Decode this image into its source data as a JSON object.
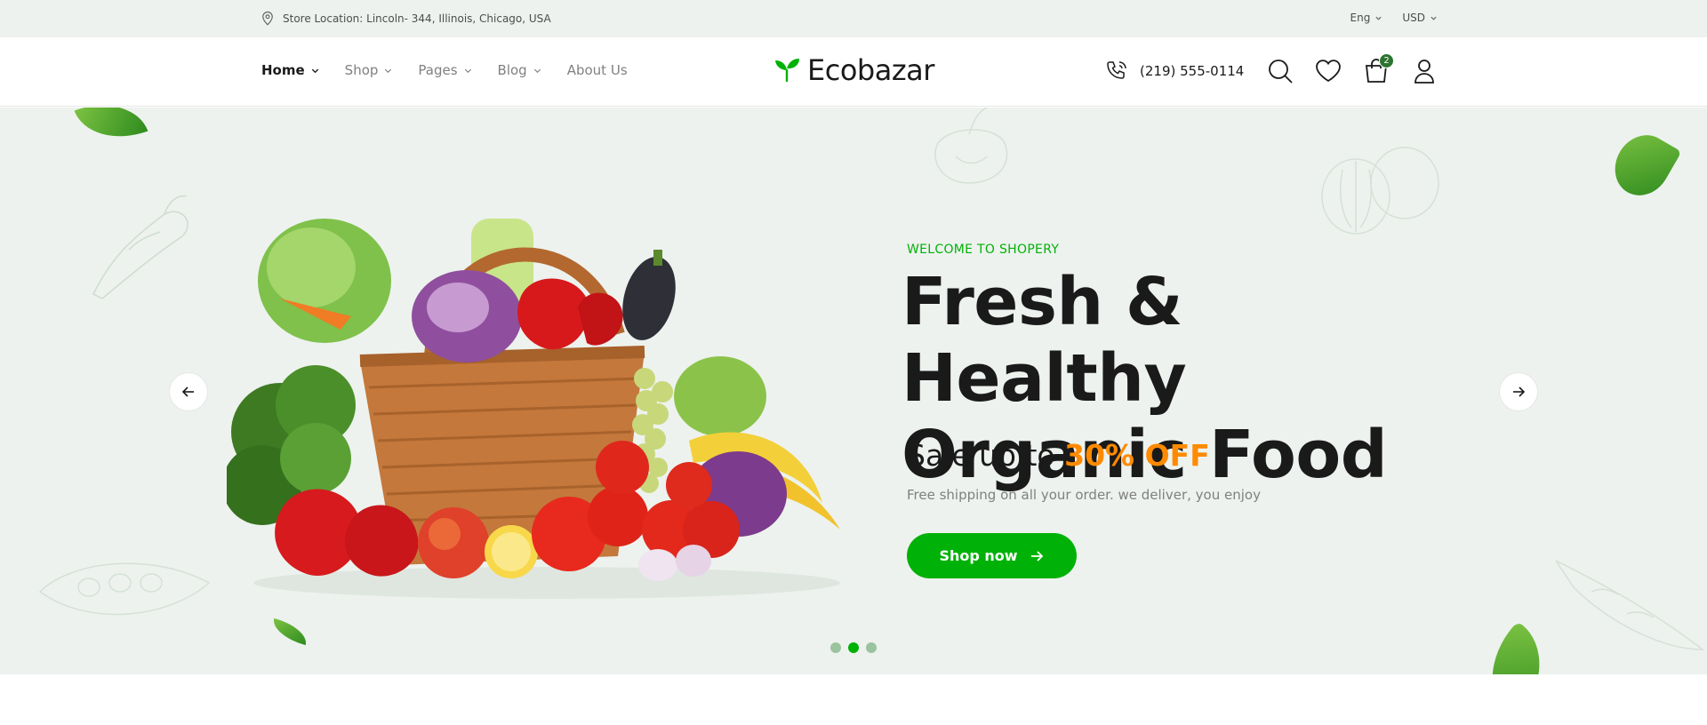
{
  "topbar": {
    "location": "Store Location: Lincoln- 344, Illinois, Chicago, USA",
    "language": "Eng",
    "currency": "USD"
  },
  "header": {
    "nav": [
      {
        "label": "Home",
        "dropdown": true,
        "active": true
      },
      {
        "label": "Shop",
        "dropdown": true
      },
      {
        "label": "Pages",
        "dropdown": true
      },
      {
        "label": "Blog",
        "dropdown": true
      },
      {
        "label": "About Us",
        "dropdown": false
      }
    ],
    "logo_text": "Ecobazar",
    "phone": "(219) 555-0114",
    "cart_count": "2"
  },
  "hero": {
    "welcome": "WELCOME TO SHOPERY",
    "title_line1": "Fresh & Healthy",
    "title_line2": "Organic Food",
    "sale_prefix": "Sale up to",
    "sale_value": "30% OFF",
    "description": "Free shipping on all your order. we deliver, you enjoy",
    "cta_label": "Shop now",
    "active_slide": 2,
    "slide_count": 3
  },
  "colors": {
    "primary": "#00b207",
    "accent": "#ff8a00",
    "hero_bg": "#edf2ee",
    "dark_green": "#2c742f"
  },
  "icons": [
    "map-pin-icon",
    "chevron-down-icon",
    "leaf-logo-icon",
    "phone-call-icon",
    "search-icon",
    "heart-icon",
    "bag-icon",
    "user-icon",
    "arrow-left-icon",
    "arrow-right-icon"
  ]
}
